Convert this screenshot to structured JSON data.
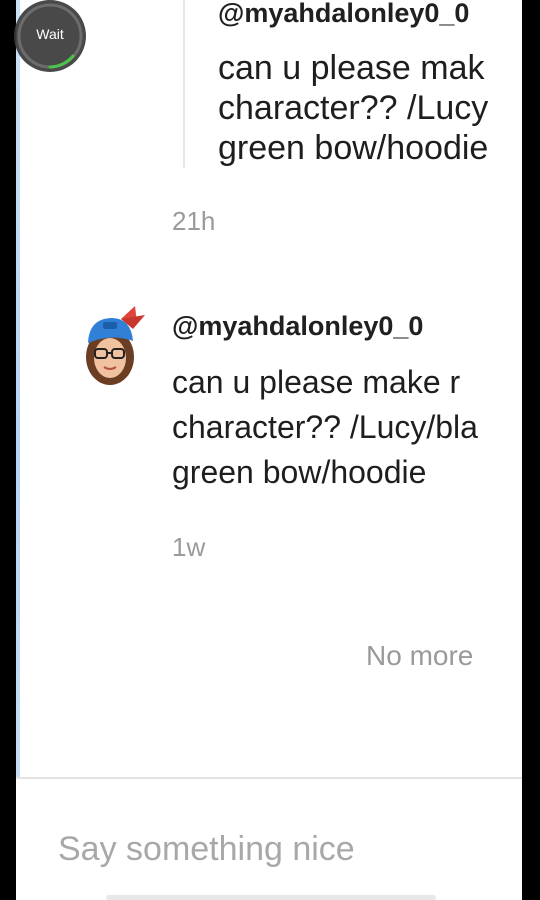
{
  "wait_indicator": {
    "label": "Wait"
  },
  "comments": [
    {
      "username": "@myahdalonley0_0",
      "lines": [
        "can u please mak",
        "character?? /Lucy",
        "green bow/hoodie"
      ],
      "time": "21h"
    },
    {
      "username": "@myahdalonley0_0",
      "lines": [
        "can u please make r",
        "character?? /Lucy/bla",
        "green bow/hoodie"
      ],
      "time": "1w"
    }
  ],
  "list_end_text": "No more",
  "comment_input": {
    "placeholder": "Say something nice"
  },
  "colors": {
    "background": "#ffffff",
    "text": "#1e1e1e",
    "muted": "#9a9a9a",
    "frame": "#000000",
    "avatar_cap": "#2f80d6",
    "avatar_bow": "#e0453a"
  },
  "icons": {
    "wait": "spinner-ring-icon",
    "avatar": "bitmoji-avatar-icon"
  }
}
